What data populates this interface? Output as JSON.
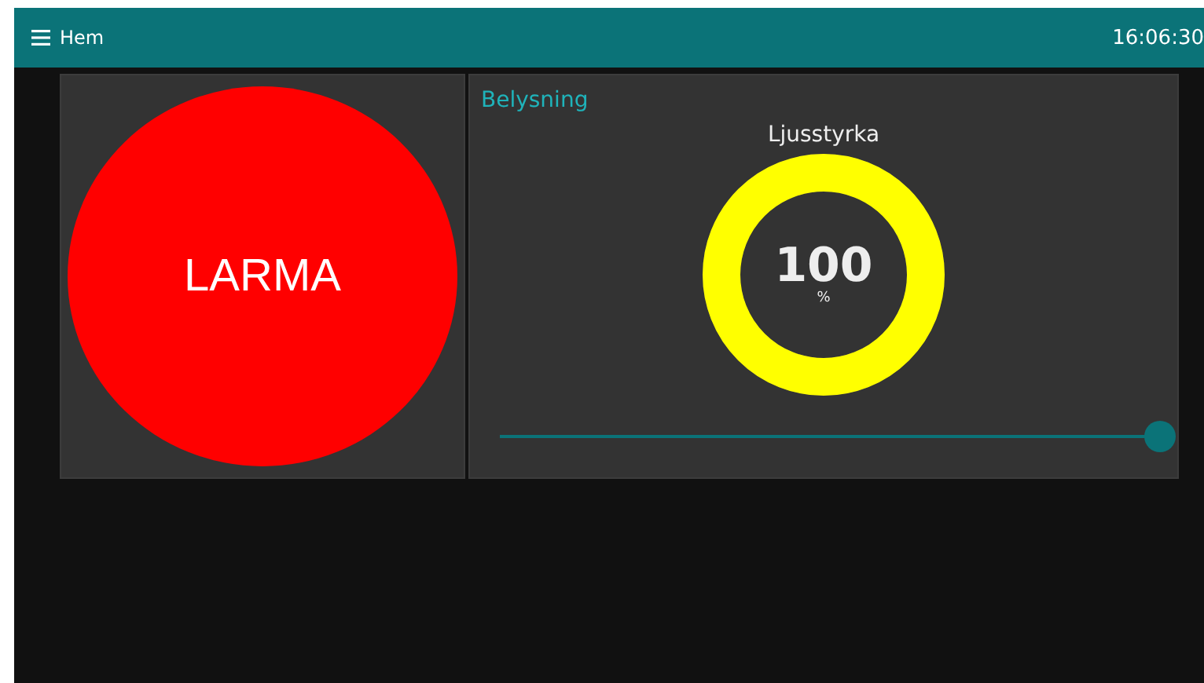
{
  "header": {
    "title": "Hem",
    "time": "16:06:30"
  },
  "alarm": {
    "label": "LARMA"
  },
  "lighting": {
    "title": "Belysning",
    "gauge": {
      "label": "Ljusstyrka",
      "value": "100",
      "unit": "%",
      "level": 1
    },
    "slider": {
      "level": 1
    }
  }
}
